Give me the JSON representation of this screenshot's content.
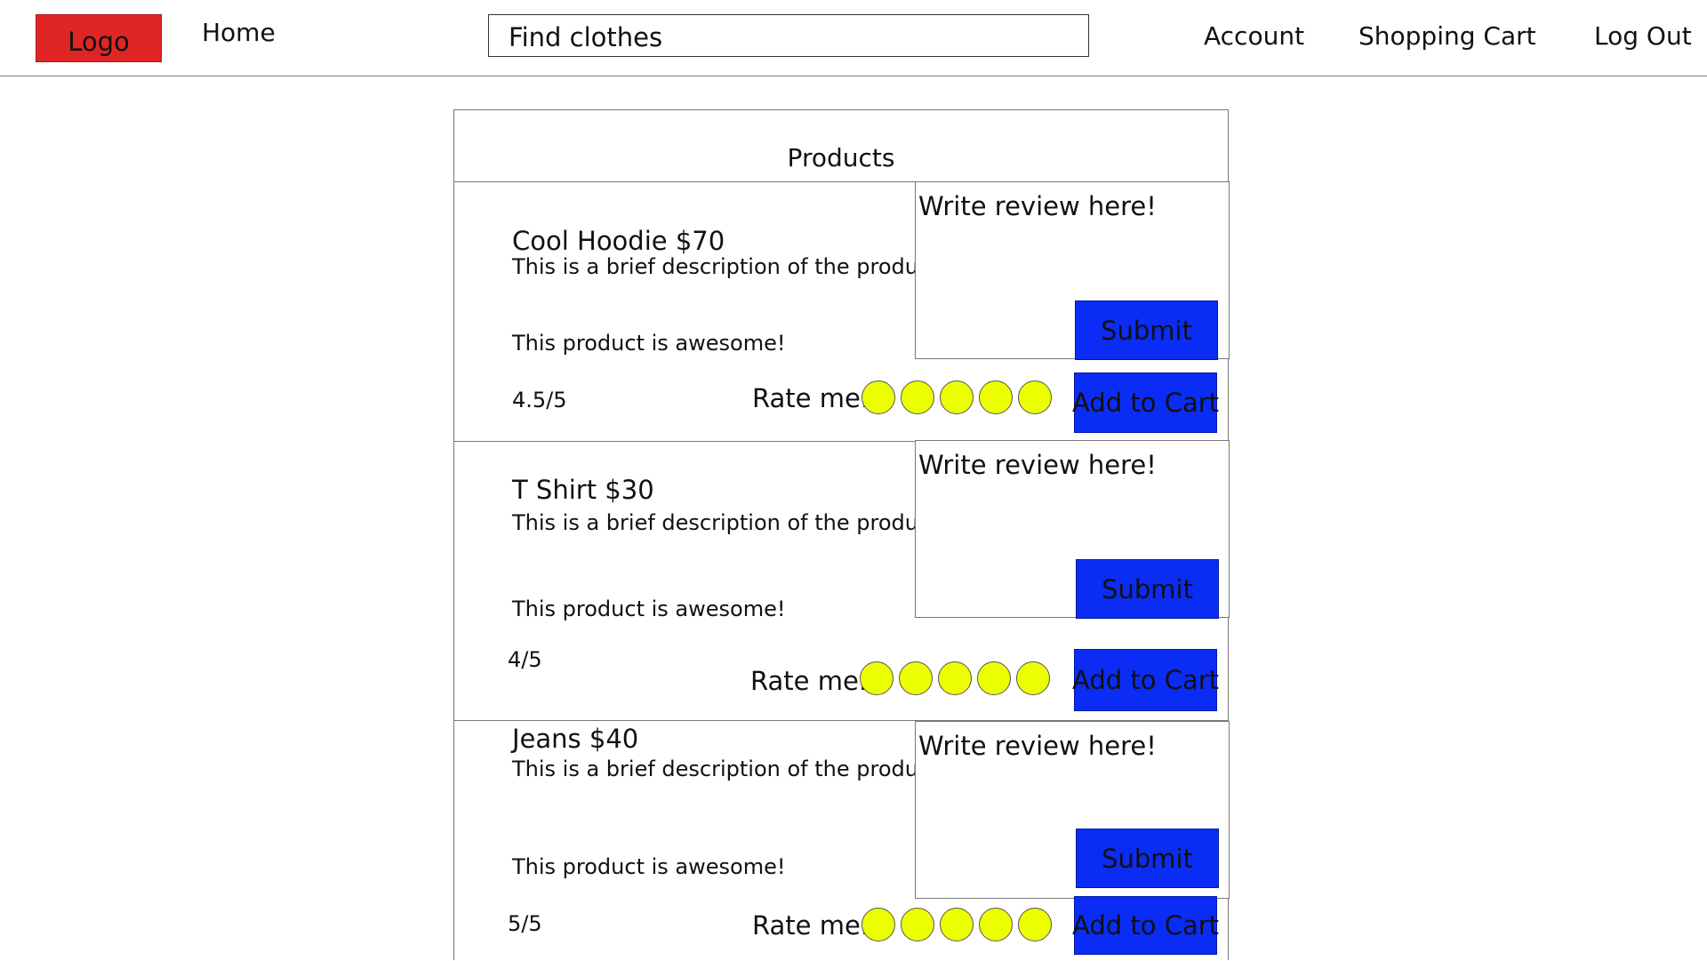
{
  "nav": {
    "logo": "Logo",
    "home": "Home",
    "search_placeholder": "Find clothes",
    "account": "Account",
    "cart": "Shopping Cart",
    "logout": "Log Out"
  },
  "panel": {
    "title": "Products"
  },
  "products": [
    {
      "name": "Cool Hoodie $70",
      "description": "This is a brief description of the product!",
      "review": "This product is awesome!",
      "rating": "4.5/5",
      "review_placeholder": "Write review here!",
      "submit": "Submit",
      "rate_label": "Rate me:",
      "add_to_cart": "Add to Cart"
    },
    {
      "name": "T Shirt $30",
      "description": "This is a brief description of the product!",
      "review": "This product is awesome!",
      "rating": "4/5",
      "review_placeholder": "Write review here!",
      "submit": "Submit",
      "rate_label": "Rate me:",
      "add_to_cart": "Add to Cart"
    },
    {
      "name": "Jeans $40",
      "description": "This is a brief description of the product!",
      "review": "This product is awesome!",
      "rating": "5/5",
      "review_placeholder": "Write review here!",
      "submit": "Submit",
      "rate_label": "Rate me:",
      "add_to_cart": "Add to Cart"
    }
  ],
  "colors": {
    "logo_bg": "#e02525",
    "button_bg": "#0a2cf5",
    "rating_circle": "#ecff00"
  }
}
